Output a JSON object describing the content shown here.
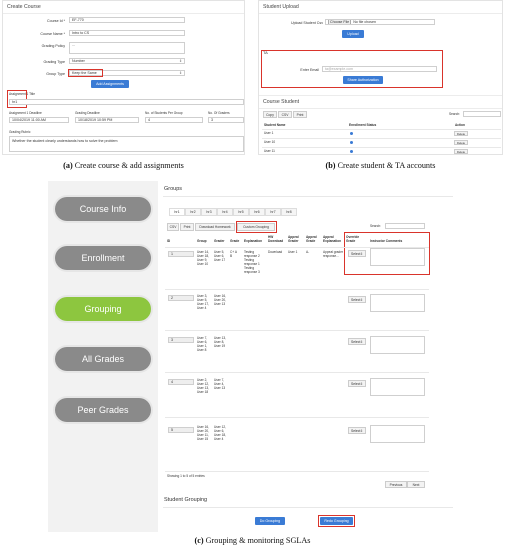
{
  "panel_a": {
    "title": "Create Course",
    "labels": [
      "Course Id *",
      "Course Name *",
      "Grading Policy",
      "Grading Type",
      "Group Type"
    ],
    "values": {
      "course_id": "EF-770",
      "course_name": "Intro to CS",
      "grading_policy": "...",
      "grading_type": "Number",
      "group_type": "Keep the Same"
    },
    "add_assignments": "Add Assignments",
    "assignment_title_label": "Assignment 1 Title",
    "assignment_title_value": "hr1",
    "deadline_labels": [
      "Assignment 1 Deadline",
      "Grading Deadline",
      "No. of Students Per Group",
      "No. Of Graders"
    ],
    "deadline_values": [
      "10/04/2019 11:00 AM",
      "10/18/2019 10:59 PM",
      "4",
      "3"
    ],
    "rubric_label": "Grading Rubric",
    "rubric_value": "Whether the student clearly understands how to solve the problem"
  },
  "panel_b": {
    "title": "Student Upload",
    "upload_label": "Upload Student Csv",
    "choose_file": "Choose File",
    "no_file": "No file chosen",
    "upload_btn": "Upload",
    "ta_title": "TA",
    "enter_email_label": "Enter Email",
    "email_value": "ta@example.com",
    "share_auth": "Share Authorization",
    "course_student_title": "Course Student",
    "tools": [
      "Copy",
      "CSV",
      "Print"
    ],
    "search_label": "Search:",
    "headers": [
      "Student Name",
      "Enrollment Status",
      "Action"
    ],
    "rows": [
      {
        "name": "User 1",
        "action": "Delete"
      },
      {
        "name": "User 10",
        "action": "Delete"
      },
      {
        "name": "User 11",
        "action": "Delete"
      }
    ]
  },
  "panel_c": {
    "sidebar": [
      "Course Info",
      "Enrollment",
      "Grouping",
      "All Grades",
      "Peer Grades"
    ],
    "sidebar_colors": [
      "#8a8a8a",
      "#8a8a8a",
      "#8dc63f",
      "#8a8a8a",
      "#8a8a8a"
    ],
    "groups_title": "Groups",
    "hw_tabs": [
      "hr1",
      "hr2",
      "hr3",
      "hr4",
      "hr5",
      "hr6",
      "hr7",
      "hr8"
    ],
    "tools": [
      "CSV",
      "Print",
      "Download Homework",
      "Custom Grouping"
    ],
    "search_label": "Search:",
    "headers": [
      "ID",
      "Group",
      "Grader",
      "Grade",
      "Explanation",
      "HW Download",
      "Appeal Grader",
      "Appeal Grade",
      "Appeal Explanation",
      "Override Grade",
      "Instructor Comments"
    ],
    "groups": [
      {
        "id": "1",
        "group": "User 14, User 18, User 9, User 10",
        "grader": "User 5, User 6, User 17",
        "grade": "C+ A B",
        "explanation": "Testing response 2 Testing response 1 Testing response 3",
        "download": "Download",
        "appeal_grader": "User 1",
        "appeal_grade": "A-",
        "appeal_expl": "Appeal grader response...",
        "select": "Select"
      },
      {
        "id": "2",
        "group": "User 3, User 5, User 17, User 4",
        "grader": "User 16, User 20, User 13",
        "select": "Select"
      },
      {
        "id": "3",
        "group": "User 7, User 6, User 1, User 8",
        "grader": "User 13, User 8, User 19",
        "select": "Select"
      },
      {
        "id": "4",
        "group": "User 2, User 12, User 13, User 18",
        "grader": "User 7, User 4, User 13",
        "select": "Select"
      },
      {
        "id": "5",
        "group": "User 16, User 20, User 11, User 15",
        "grader": "User 12, User 6, User 18, User 4",
        "select": "Select"
      }
    ],
    "showing": "Showing 1 to 5 of 5 entries",
    "previous": "Previous",
    "next": "Next",
    "student_grouping_title": "Student Grouping",
    "do_grouping": "Do Grouping",
    "redo_grouping": "Redo Grouping"
  },
  "captions": {
    "a_tag": "(a)",
    "a_text": " Create course & add assignments",
    "b_tag": "(b)",
    "b_text": " Create student & TA accounts",
    "c_tag": "(c)",
    "c_text": " Grouping & monitoring SGLAs"
  }
}
